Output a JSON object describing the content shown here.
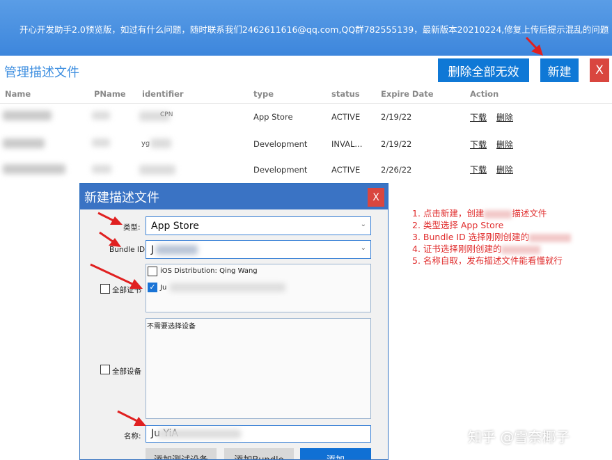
{
  "banner": {
    "text": "开心开发助手2.0预览版，如过有什么问题，随时联系我们2462611616@qq.com,QQ群782555139，最新版本20210224,修复上传后提示混乱的问题"
  },
  "header": {
    "title": "管理描述文件",
    "delete_invalid_label": "删除全部无效",
    "new_label": "新建",
    "close_label": "X"
  },
  "table": {
    "columns": [
      "Name",
      "PName",
      "identifier",
      "type",
      "status",
      "Expire Date",
      "Action"
    ],
    "rows": [
      {
        "identifier_partial": "CPN",
        "type": "App Store",
        "status": "ACTIVE",
        "expire": "2/19/22",
        "download": "下载",
        "delete": "删除"
      },
      {
        "identifier_partial": "yg",
        "type": "Development",
        "status": "INVAL...",
        "expire": "2/19/22",
        "download": "下载",
        "delete": "删除"
      },
      {
        "identifier_partial": "",
        "type": "Development",
        "status": "ACTIVE",
        "expire": "2/26/22",
        "download": "下载",
        "delete": "删除"
      }
    ]
  },
  "notes": [
    "1. 点击新建，创建",
    "描述文件",
    "2. 类型选择  App Store",
    "3. Bundle ID 选择刚刚创建的",
    "4. 证书选择刚刚创建的",
    "5. 名称自取，发布描述文件能看懂就行"
  ],
  "dialog": {
    "title": "新建描述文件",
    "close_label": "X",
    "type_label": "类型:",
    "type_value": "App Store",
    "bundle_label": "Bundle ID:",
    "bundle_value": "J",
    "all_certs_label": "全部证书",
    "certs": [
      {
        "label": "iOS Distribution: Qing Wang",
        "checked": false
      },
      {
        "label": "Ju",
        "checked": true
      }
    ],
    "all_devices_label": "全部设备",
    "devices_note": "不需要选择设备",
    "name_label": "名称:",
    "name_value": "Ju   YiA",
    "add_test_device_label": "添加测试设备",
    "add_bundle_label": "添加Bundle",
    "add_label": "添加"
  },
  "watermark": "知乎 @雪奈椰子",
  "colors": {
    "banner": "#3d86dc",
    "primary_button": "#0f78d6",
    "danger_button": "#d9463f",
    "dialog_header": "#3a73c4",
    "annotation": "#e02c2c"
  }
}
